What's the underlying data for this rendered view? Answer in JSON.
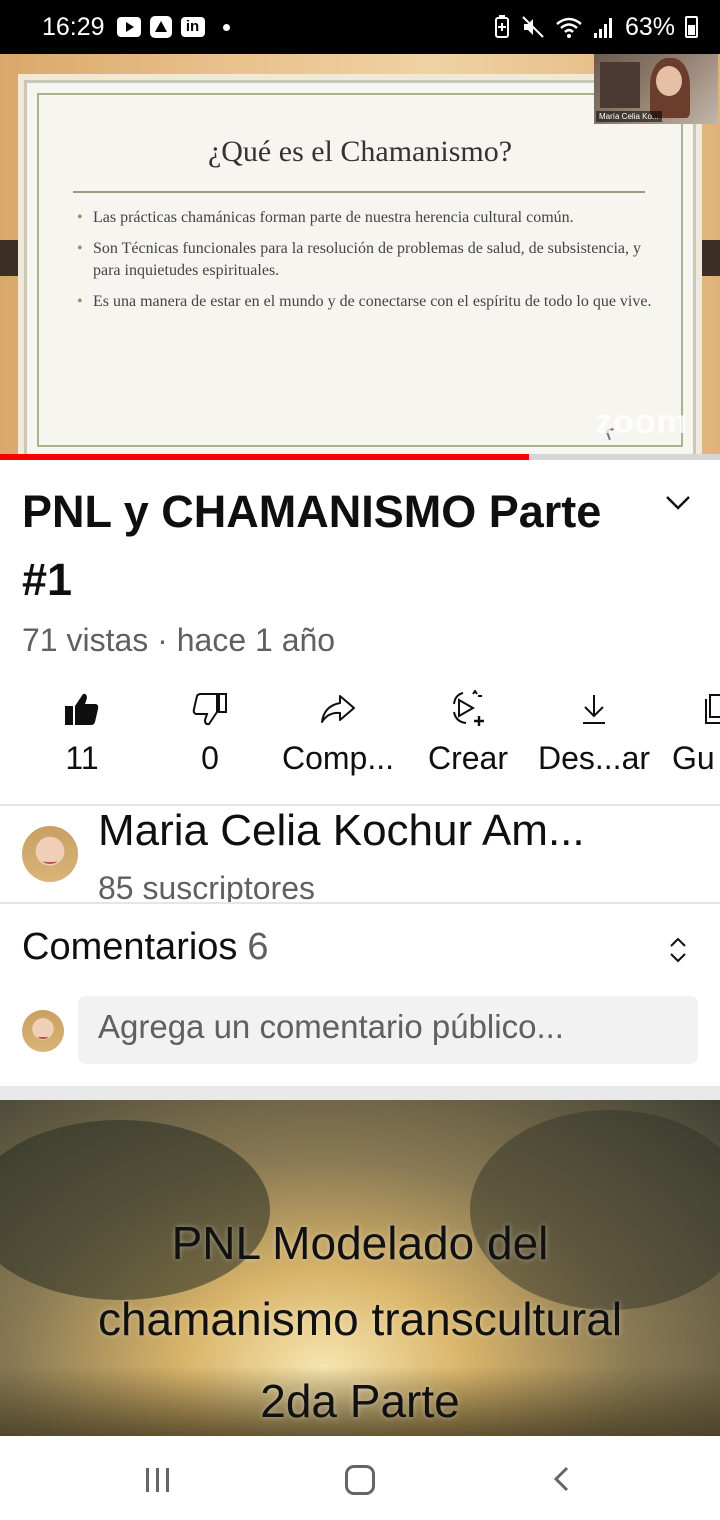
{
  "status_bar": {
    "time": "16:29",
    "battery": "63%",
    "icons": [
      "youtube-icon",
      "maps-icon",
      "linkedin-icon",
      "dot-icon",
      "battery-saver-icon",
      "mute-icon",
      "wifi-icon",
      "signal-icon",
      "battery-icon"
    ]
  },
  "video": {
    "slide_title": "¿Qué es el Chamanismo?",
    "slide_bullets": [
      "Las prácticas chamánicas forman parte de nuestra herencia cultural común.",
      "Son Técnicas funcionales para la resolución de problemas de salud, de subsistencia, y para inquietudes espirituales.",
      "Es una manera de estar en el mundo y de conectarse con el espíritu de todo lo que vive."
    ],
    "watermark": "zoom",
    "pip_name": "María Celia Ko...",
    "progress_fraction": 0.735,
    "progress_color": "#ff0000"
  },
  "title": "PNL y CHAMANISMO Parte #1",
  "meta": "71 vistas · hace 1 año",
  "actions": [
    {
      "icon": "thumbs-up-icon",
      "label": "11"
    },
    {
      "icon": "thumbs-down-icon",
      "label": "0"
    },
    {
      "icon": "share-icon",
      "label": "Comp..."
    },
    {
      "icon": "remix-icon",
      "label": "Crear"
    },
    {
      "icon": "download-icon",
      "label": "Des...ar"
    },
    {
      "icon": "save-icon",
      "label": "Gu"
    }
  ],
  "channel": {
    "name": "Maria Celia Kochur Am...",
    "subscribers": "85 suscriptores"
  },
  "comments": {
    "title": "Comentarios",
    "count": "6",
    "placeholder": "Agrega un comentario público..."
  },
  "next_video": {
    "lines": [
      "PNL  Modelado del",
      "chamanismo transcultural",
      "2da Parte"
    ]
  },
  "colors": {
    "accent": "#ff0000",
    "text_primary": "#0f0f0f",
    "text_secondary": "#606060"
  }
}
